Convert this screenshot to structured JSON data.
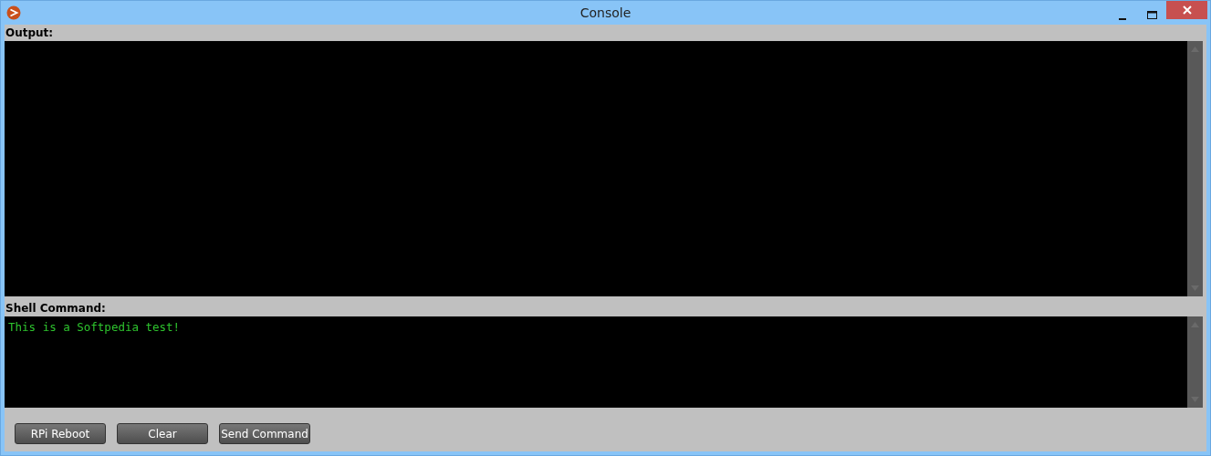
{
  "window": {
    "title": "Console"
  },
  "output": {
    "label": "Output:"
  },
  "shell_command": {
    "label": "Shell Command:",
    "value": "This is a Softpedia test!"
  },
  "buttons": [
    {
      "label": "RPi Reboot"
    },
    {
      "label": "Clear"
    },
    {
      "label": "Send Command"
    }
  ]
}
